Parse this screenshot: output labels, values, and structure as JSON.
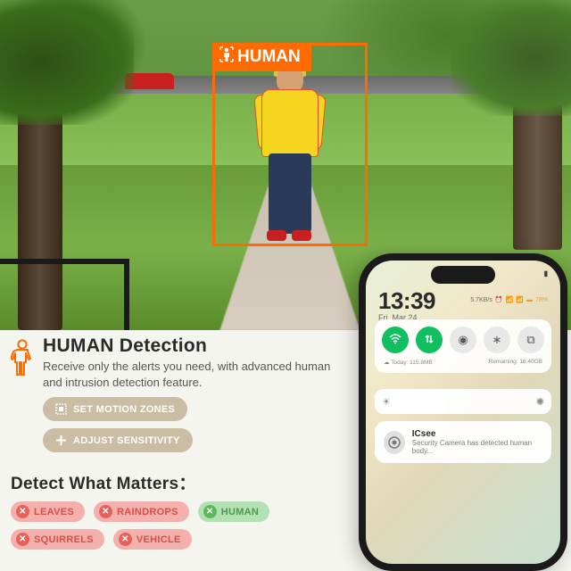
{
  "detection": {
    "box_label": "HUMAN"
  },
  "info": {
    "title": "HUMAN Detection",
    "description": "Receive only the alerts you need, with advanced human and intrusion detection feature.",
    "btn_zones": "SET MOTION ZONES",
    "btn_sensitivity": "ADJUST SENSITIVITY"
  },
  "matters": {
    "title": "Detect What Matters：",
    "chips": {
      "leaves": "LEAVES",
      "raindrops": "RAINDROPS",
      "human": "HUMAN",
      "squirrels": "SQUIRRELS",
      "vehicle": "VEHICLE"
    }
  },
  "phone": {
    "time": "13:39",
    "date": "Fri, Mar 24",
    "net_speed": "5.7KB/s",
    "battery_pct": "78%",
    "data_today_label": "Today:",
    "data_today": "115.8MB",
    "data_remaining_label": "Remaining:",
    "data_remaining": "16.40GB",
    "notif_app": "ICsee",
    "notif_msg": "Security Camera has detected human body..."
  },
  "colors": {
    "accent_orange": "#ff6b00",
    "chip_reject": "#f4b0ac",
    "chip_accept": "#b4e0b4",
    "btn_beige": "#cbbda4",
    "toggle_green": "#10c060"
  }
}
